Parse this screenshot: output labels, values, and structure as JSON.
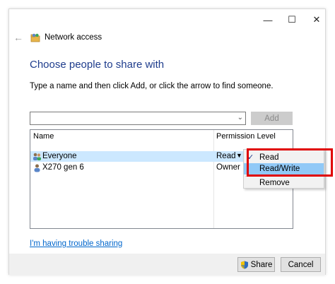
{
  "window": {
    "controls": {
      "minimize": "—",
      "maximize": "☐",
      "close": "✕"
    }
  },
  "nav": {
    "back_glyph": "←",
    "title": "Network access",
    "icon": "network-share-icon"
  },
  "heading": "Choose people to share with",
  "instruction": "Type a name and then click Add, or click the arrow to find someone.",
  "name_input": {
    "value": "",
    "arrow": "⌄"
  },
  "add_button": "Add",
  "list": {
    "headers": {
      "name": "Name",
      "permission": "Permission Level"
    },
    "rows": [
      {
        "name": "Everyone",
        "permission": "Read",
        "arrow": "▼",
        "icon": "group-users-icon",
        "selected": true
      },
      {
        "name": "X270 gen 6",
        "permission": "Owner",
        "icon": "user-icon",
        "selected": false
      }
    ]
  },
  "permission_menu": {
    "items": [
      {
        "label": "Read",
        "checked": true
      },
      {
        "label": "Read/Write",
        "highlighted": true
      },
      {
        "label": "Remove"
      }
    ],
    "check_glyph": "✓"
  },
  "trouble_link": "I'm having trouble sharing",
  "footer": {
    "share": "Share",
    "cancel": "Cancel"
  },
  "colors": {
    "heading": "#1e3c8c",
    "link": "#0066cc",
    "selection": "#cce8ff",
    "menu_highlight": "#91c9f7",
    "annotation_box": "#e00000"
  }
}
